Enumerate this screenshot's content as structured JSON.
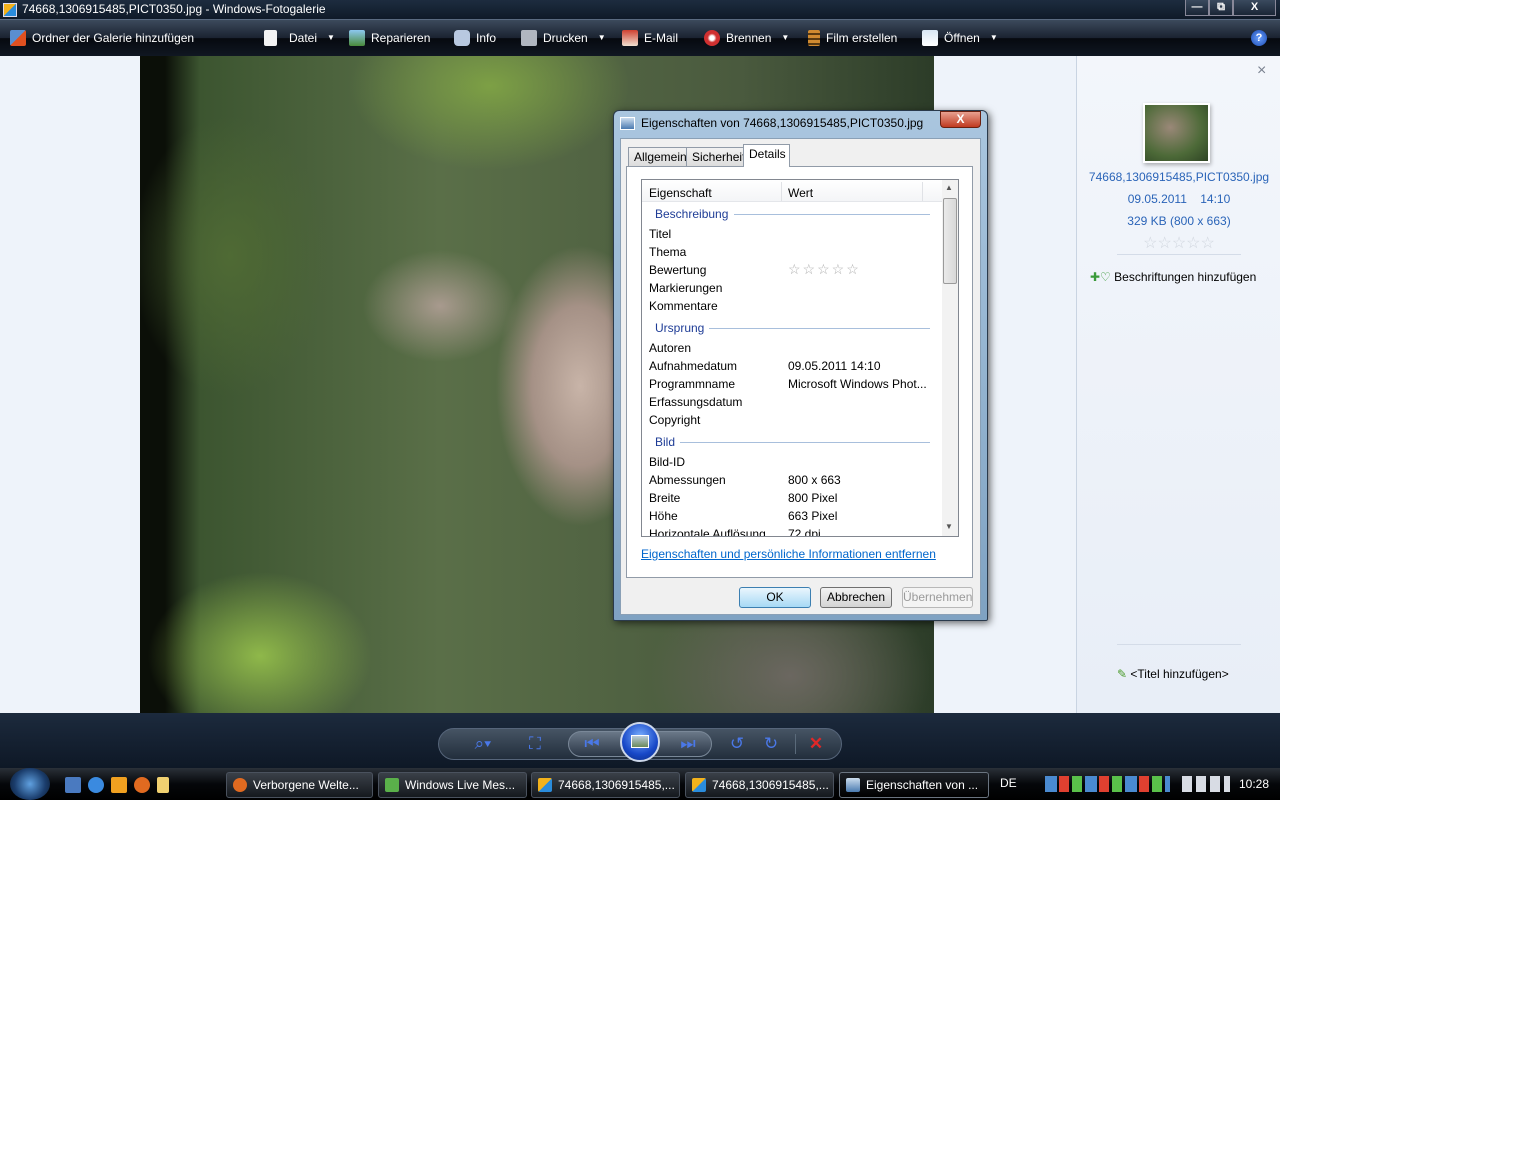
{
  "window": {
    "title": "74668,1306915485,PICT0350.jpg - Windows-Fotogalerie",
    "min_label": "—",
    "max_label": "⧉",
    "close_label": "X"
  },
  "toolbar": {
    "add_folder": "Ordner der Galerie hinzufügen",
    "file": "Datei",
    "fix": "Reparieren",
    "info": "Info",
    "print": "Drucken",
    "email": "E-Mail",
    "burn": "Brennen",
    "movie": "Film erstellen",
    "open": "Öffnen",
    "help": "?"
  },
  "info_panel": {
    "close": "×",
    "filename": "74668,1306915485,PICT0350.jpg",
    "date": "09.05.2011    14:10",
    "size": "329 KB (800 x 663)",
    "rating": 0,
    "add_tags": "Beschriftungen hinzufügen",
    "add_title": "<Titel hinzufügen>"
  },
  "dialog": {
    "title": "Eigenschaften von 74668,1306915485,PICT0350.jpg",
    "close": "X",
    "tabs": [
      "Allgemein",
      "Sicherheit",
      "Details"
    ],
    "active_tab": "Details",
    "columns": [
      "Eigenschaft",
      "Wert"
    ],
    "groups": {
      "description": "Beschreibung",
      "origin": "Ursprung",
      "image": "Bild"
    },
    "rows": {
      "title": "Titel",
      "subject": "Thema",
      "rating": "Bewertung",
      "tags": "Markierungen",
      "comments": "Kommentare",
      "authors": "Autoren",
      "date_taken": "Aufnahmedatum",
      "date_taken_value": "09.05.2011 14:10",
      "program": "Programmname",
      "program_value": "Microsoft Windows Phot...",
      "acquired": "Erfassungsdatum",
      "copyright": "Copyright",
      "image_id": "Bild-ID",
      "dimensions": "Abmessungen",
      "dimensions_value": "800 x 663",
      "width": "Breite",
      "width_value": "800 Pixel",
      "height": "Höhe",
      "height_value": "663 Pixel",
      "hres": "Horizontale Auflösung",
      "hres_value": "72 dpi"
    },
    "remove_link": "Eigenschaften und persönliche Informationen entfernen",
    "ok": "OK",
    "cancel": "Abbrechen",
    "apply": "Übernehmen"
  },
  "controls": {
    "zoom": "⌕▾",
    "fit": "⛶",
    "prev": "⏮",
    "next": "⏭",
    "rotate_left": "↺",
    "rotate_right": "↻",
    "delete": "✕"
  },
  "taskbar": {
    "tasks": [
      "Verborgene Welte...",
      "Windows Live Mes...",
      "74668,1306915485,...",
      "74668,1306915485,...",
      "Eigenschaften von ..."
    ],
    "language": "DE",
    "clock": "10:28"
  }
}
